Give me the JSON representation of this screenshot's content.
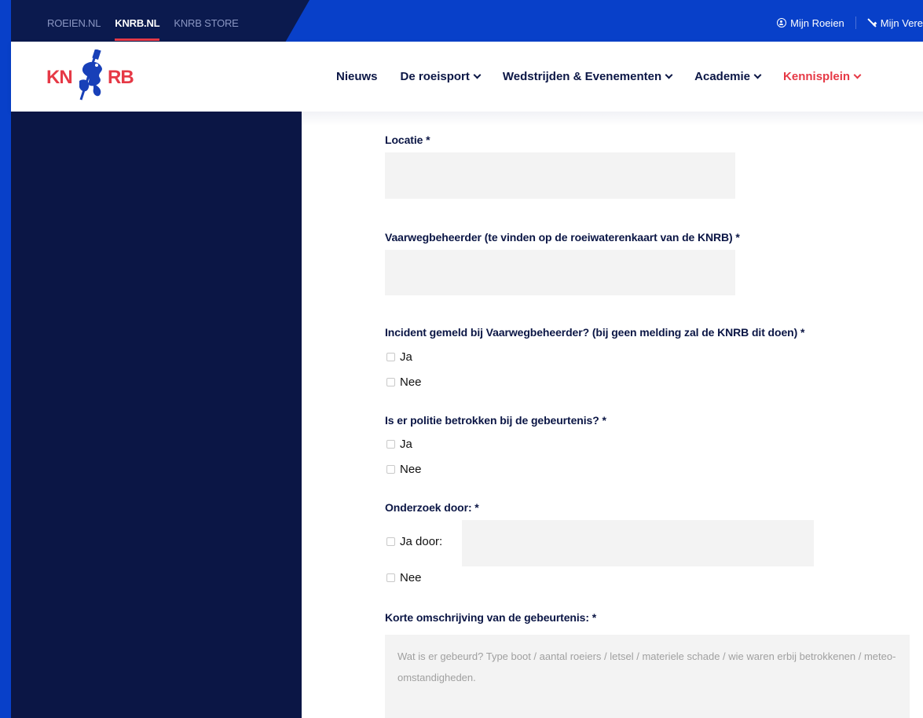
{
  "topbar": {
    "links": [
      "ROEIEN.NL",
      "KNRB.NL",
      "KNRB STORE"
    ],
    "active": "KNRB.NL",
    "account_links": [
      "Mijn Roeien",
      "Mijn Vere"
    ]
  },
  "header": {
    "logo_left": "KN",
    "logo_right": "RB",
    "nav": [
      "Nieuws",
      "De roeisport",
      "Wedstrijden & Evenementen",
      "Academie",
      "Kennisplein"
    ],
    "nav_highlight_color": "#e63946"
  },
  "form": {
    "locatie_label": "Locatie *",
    "locatie_value": "",
    "vaarweg_label": "Vaarwegbeheerder (te vinden op de roeiwaterenkaart van de KNRB) *",
    "vaarweg_value": "",
    "gemeld_label": "Incident gemeld bij Vaarwegbeheerder? (bij geen melding zal de KNRB dit doen) *",
    "gemeld_options": [
      "Ja",
      "Nee"
    ],
    "politie_label": "Is er politie betrokken bij de gebeurtenis? *",
    "politie_options": [
      "Ja",
      "Nee"
    ],
    "onderzoek_label": "Onderzoek door: *",
    "onderzoek_options": [
      "Ja door:",
      "Nee"
    ],
    "onderzoek_door_value": "",
    "omschrijving_label": "Korte omschrijving van de gebeurtenis: *",
    "omschrijving_placeholder": "Wat is er gebeurd? Type boot / aantal roeiers / letsel / materiele schade / wie waren erbij betrokkenen / meteo-omstandigheden."
  },
  "colors": {
    "brand_blue": "#0840c9",
    "navy": "#0b1645",
    "accent_red": "#e63946",
    "field_bg": "#f3f3f3"
  }
}
